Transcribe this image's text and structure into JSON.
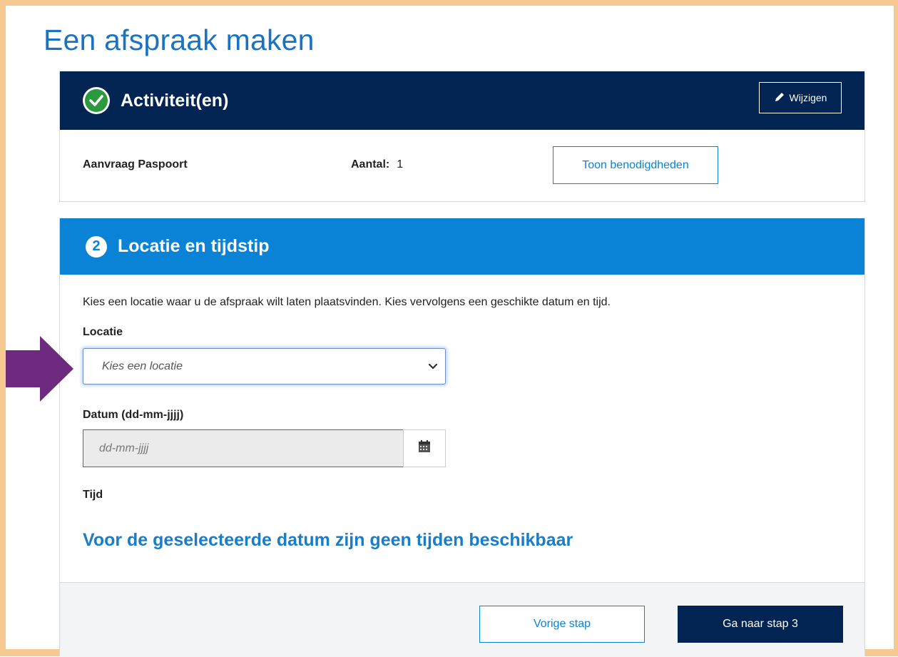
{
  "page": {
    "title": "Een afspraak maken"
  },
  "step1": {
    "title": "Activiteit(en)",
    "edit_label": "Wijzigen",
    "activity": {
      "name": "Aanvraag Paspoort",
      "count_label": "Aantal:",
      "count_value": "1",
      "needs_button": "Toon benodigdheden"
    }
  },
  "step2": {
    "number": "2",
    "title": "Locatie en tijdstip",
    "intro": "Kies een locatie waar u de afspraak wilt laten plaatsvinden. Kies vervolgens een geschikte datum en tijd.",
    "location_label": "Locatie",
    "location_value": "Kies een locatie",
    "date_label": "Datum (dd-mm-jjjj)",
    "date_placeholder": "dd-mm-jjjj",
    "time_label": "Tijd",
    "no_times_message": "Voor de geselecteerde datum zijn geen tijden beschikbaar"
  },
  "footer": {
    "prev_label": "Vorige stap",
    "next_label": "Ga naar stap 3"
  },
  "colors": {
    "frame": "#f5c98f",
    "navy": "#012452",
    "blue": "#0a82d5",
    "check_green": "#2b9a3e",
    "arrow_purple": "#6e2a7f"
  },
  "icons": {
    "check": "check-circle-icon",
    "edit": "pencil-icon",
    "chevron": "chevron-down-icon",
    "calendar": "calendar-icon",
    "arrow": "arrow-right-icon"
  }
}
